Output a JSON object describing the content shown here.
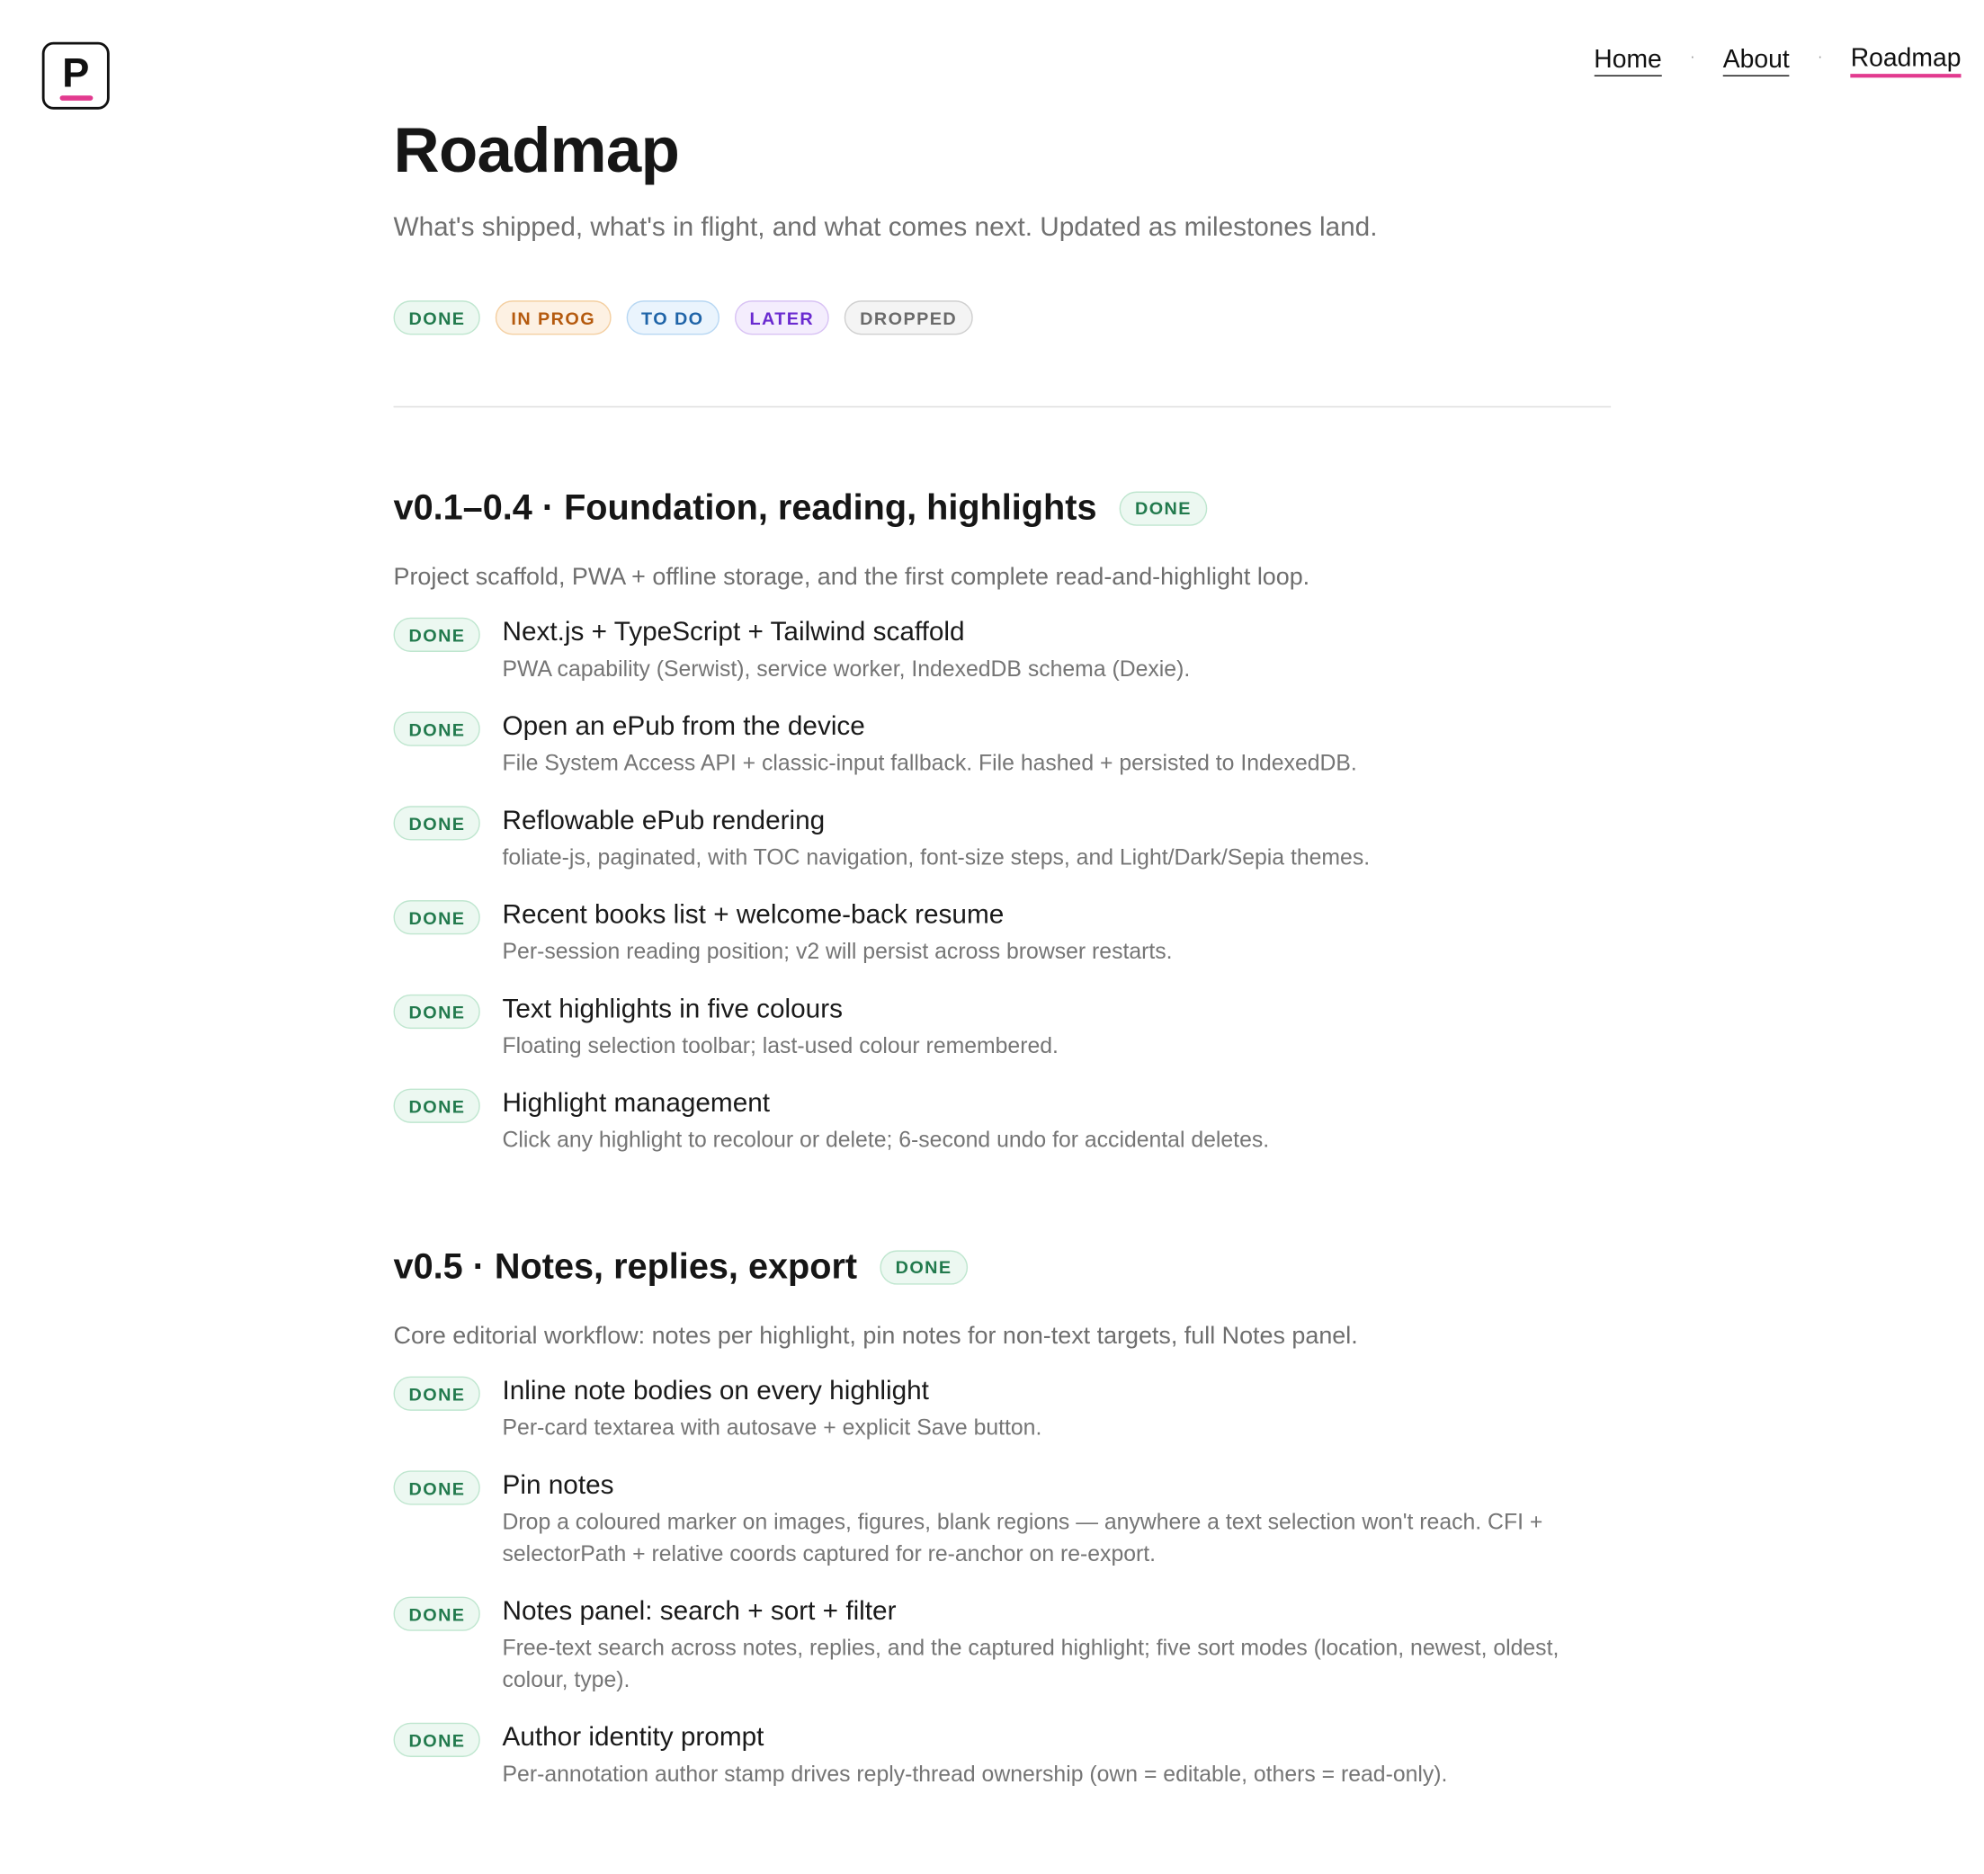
{
  "logo": {
    "letter": "P"
  },
  "nav": {
    "items": [
      {
        "label": "Home"
      },
      {
        "label": "About"
      },
      {
        "label": "Roadmap"
      }
    ],
    "separator": "·"
  },
  "header": {
    "title": "Roadmap",
    "subtitle": "What's shipped, what's in flight, and what comes next. Updated as milestones land."
  },
  "legend": [
    "DONE",
    "IN PROG",
    "TO DO",
    "LATER",
    "DROPPED"
  ],
  "colors": {
    "accent": "#e23a8f",
    "done": "#227a4d",
    "in_progress": "#b55a0e",
    "todo": "#1f64a8",
    "later": "#6a2ad0",
    "dropped": "#6a6a6a"
  },
  "sections": [
    {
      "title": "v0.1–0.4 · Foundation, reading, highlights",
      "status": "DONE",
      "description": "Project scaffold, PWA + offline storage, and the first complete read-and-highlight loop.",
      "items": [
        {
          "status": "DONE",
          "title": "Next.js + TypeScript + Tailwind scaffold",
          "desc": "PWA capability (Serwist), service worker, IndexedDB schema (Dexie)."
        },
        {
          "status": "DONE",
          "title": "Open an ePub from the device",
          "desc": "File System Access API + classic-input fallback. File hashed + persisted to IndexedDB."
        },
        {
          "status": "DONE",
          "title": "Reflowable ePub rendering",
          "desc": "foliate-js, paginated, with TOC navigation, font-size steps, and Light/Dark/Sepia themes."
        },
        {
          "status": "DONE",
          "title": "Recent books list + welcome-back resume",
          "desc": "Per-session reading position; v2 will persist across browser restarts."
        },
        {
          "status": "DONE",
          "title": "Text highlights in five colours",
          "desc": "Floating selection toolbar; last-used colour remembered."
        },
        {
          "status": "DONE",
          "title": "Highlight management",
          "desc": "Click any highlight to recolour or delete; 6-second undo for accidental deletes."
        }
      ]
    },
    {
      "title": "v0.5 · Notes, replies, export",
      "status": "DONE",
      "description": "Core editorial workflow: notes per highlight, pin notes for non-text targets, full Notes panel.",
      "items": [
        {
          "status": "DONE",
          "title": "Inline note bodies on every highlight",
          "desc": "Per-card textarea with autosave + explicit Save button."
        },
        {
          "status": "DONE",
          "title": "Pin notes",
          "desc": "Drop a coloured marker on images, figures, blank regions — anywhere a text selection won't reach. CFI + selectorPath + relative coords captured for re-anchor on re-export."
        },
        {
          "status": "DONE",
          "title": "Notes panel: search + sort + filter",
          "desc": "Free-text search across notes, replies, and the captured highlight; five sort modes (location, newest, oldest, colour, type)."
        },
        {
          "status": "DONE",
          "title": "Author identity prompt",
          "desc": "Per-annotation author stamp drives reply-thread ownership (own = editable, others = read-only)."
        }
      ]
    }
  ]
}
